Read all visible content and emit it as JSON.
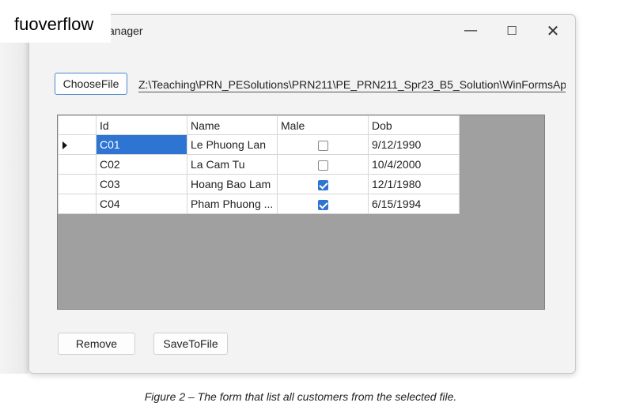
{
  "watermark": "fuoverflow",
  "window": {
    "title": "anager",
    "controls": {
      "minimize": "—",
      "maximize": "☐",
      "close": "✕"
    }
  },
  "toolbar": {
    "choose_file_label": "ChooseFile",
    "file_path": "Z:\\Teaching\\PRN_PESolutions\\PRN211\\PE_PRN211_Spr23_B5_Solution\\WinFormsApp"
  },
  "grid": {
    "columns": [
      "Id",
      "Name",
      "Male",
      "Dob"
    ],
    "rows": [
      {
        "id": "C01",
        "name": "Le Phuong Lan",
        "male": false,
        "dob": "9/12/1990"
      },
      {
        "id": "C02",
        "name": "La Cam Tu",
        "male": false,
        "dob": "10/4/2000"
      },
      {
        "id": "C03",
        "name": "Hoang Bao Lam",
        "male": true,
        "dob": "12/1/1980"
      },
      {
        "id": "C04",
        "name": "Pham Phuong ...",
        "male": true,
        "dob": "6/15/1994"
      }
    ]
  },
  "actions": {
    "remove_label": "Remove",
    "save_label": "SaveToFile"
  },
  "caption": "Figure 2 – The form that list all customers from the selected file.",
  "colors": {
    "selection": "#2e74d3",
    "grid_background": "#a0a0a0"
  }
}
